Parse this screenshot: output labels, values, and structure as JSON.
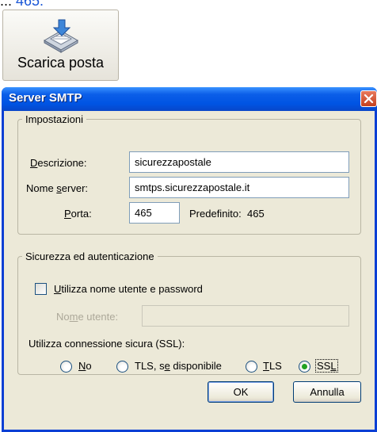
{
  "top_text": {
    "prefix": "..: ",
    "link": "465."
  },
  "toolbar": {
    "download_label": "Scarica posta",
    "icon": "download-mail-icon"
  },
  "dialog": {
    "title": "Server SMTP",
    "close_icon": "close-icon",
    "settings": {
      "legend": "Impostazioni",
      "description_label": "Descrizione:",
      "description_value": "sicurezzapostale",
      "server_label": "Nome server:",
      "server_value": "smtps.sicurezzapostale.it",
      "port_label": "Porta:",
      "port_value": "465",
      "default_port_text": "Predefinito:",
      "default_port_value": "465"
    },
    "security": {
      "legend": "Sicurezza ed autenticazione",
      "use_auth_label": "Utilizza nome utente e password",
      "use_auth_checked": false,
      "username_label": "Nome utente:",
      "username_value": "",
      "ssl_prompt": "Utilizza connessione sicura (SSL):",
      "options": [
        "No",
        "TLS, se disponibile",
        "TLS",
        "SSL"
      ],
      "selected": "SSL"
    },
    "buttons": {
      "ok": "OK",
      "cancel": "Annulla"
    }
  },
  "colors": {
    "titlebar": "#0054e3",
    "dialog_bg": "#ece9d8",
    "close_button": "#c3401e",
    "link": "#1a56d6",
    "radio_selected": "#21a121"
  }
}
